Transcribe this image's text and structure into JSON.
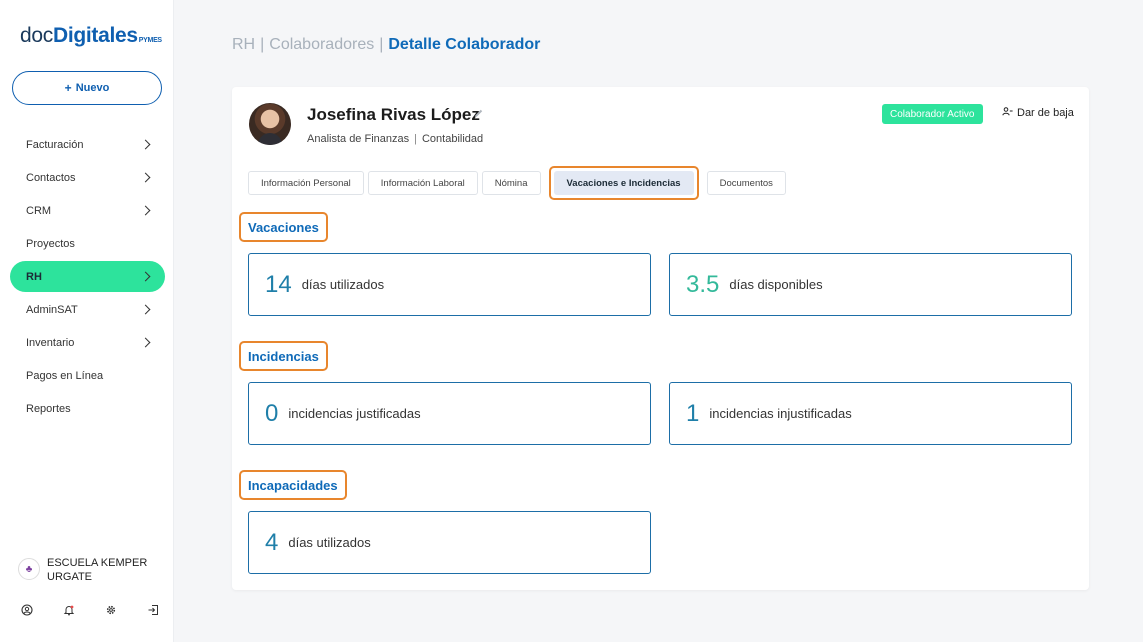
{
  "logo": {
    "doc": "doc",
    "digitales": "Digitales",
    "pymes": "PYMES"
  },
  "new_button": {
    "label": "Nuevo",
    "icon": "plus-icon"
  },
  "nav": [
    {
      "label": "Facturación",
      "has_chevron": true
    },
    {
      "label": "Contactos",
      "has_chevron": true
    },
    {
      "label": "CRM",
      "has_chevron": true
    },
    {
      "label": "Proyectos",
      "has_chevron": false
    },
    {
      "label": "RH",
      "has_chevron": true,
      "active": true
    },
    {
      "label": "AdminSAT",
      "has_chevron": true
    },
    {
      "label": "Inventario",
      "has_chevron": true
    },
    {
      "label": "Pagos en Línea",
      "has_chevron": false
    },
    {
      "label": "Reportes",
      "has_chevron": false
    }
  ],
  "company": {
    "name": "ESCUELA KEMPER URGATE"
  },
  "bottom_icons": [
    "user-icon",
    "bell-icon",
    "gear-icon",
    "logout-icon"
  ],
  "breadcrumb": {
    "level1": "RH",
    "level2": "Colaboradores",
    "current": "Detalle Colaborador"
  },
  "employee": {
    "name": "Josefina Rivas López",
    "position": "Analista de Finanzas",
    "department": "Contabilidad",
    "status": "Colaborador Activo",
    "unsubscribe_label": "Dar de baja"
  },
  "tabs": [
    {
      "label": "Información Personal"
    },
    {
      "label": "Información Laboral"
    },
    {
      "label": "Nómina"
    },
    {
      "label": "Vacaciones e Incidencias",
      "active": true
    },
    {
      "label": "Documentos"
    }
  ],
  "sections": {
    "vacaciones": {
      "title": "Vacaciones",
      "used": {
        "value": "14",
        "label": "días utilizados"
      },
      "available": {
        "value": "3.5",
        "label": "días disponibles"
      }
    },
    "incidencias": {
      "title": "Incidencias",
      "justified": {
        "value": "0",
        "label": "incidencias justificadas"
      },
      "unjustified": {
        "value": "1",
        "label": "incidencias injustificadas"
      }
    },
    "incapacidades": {
      "title": "Incapacidades",
      "used": {
        "value": "4",
        "label": "días utilizados"
      }
    }
  },
  "colors": {
    "accent": "#0f6ab8",
    "active_green": "#2de39c",
    "highlight_orange": "#e8862d",
    "number_blue": "#1f7fa9",
    "number_green": "#33b99a"
  }
}
